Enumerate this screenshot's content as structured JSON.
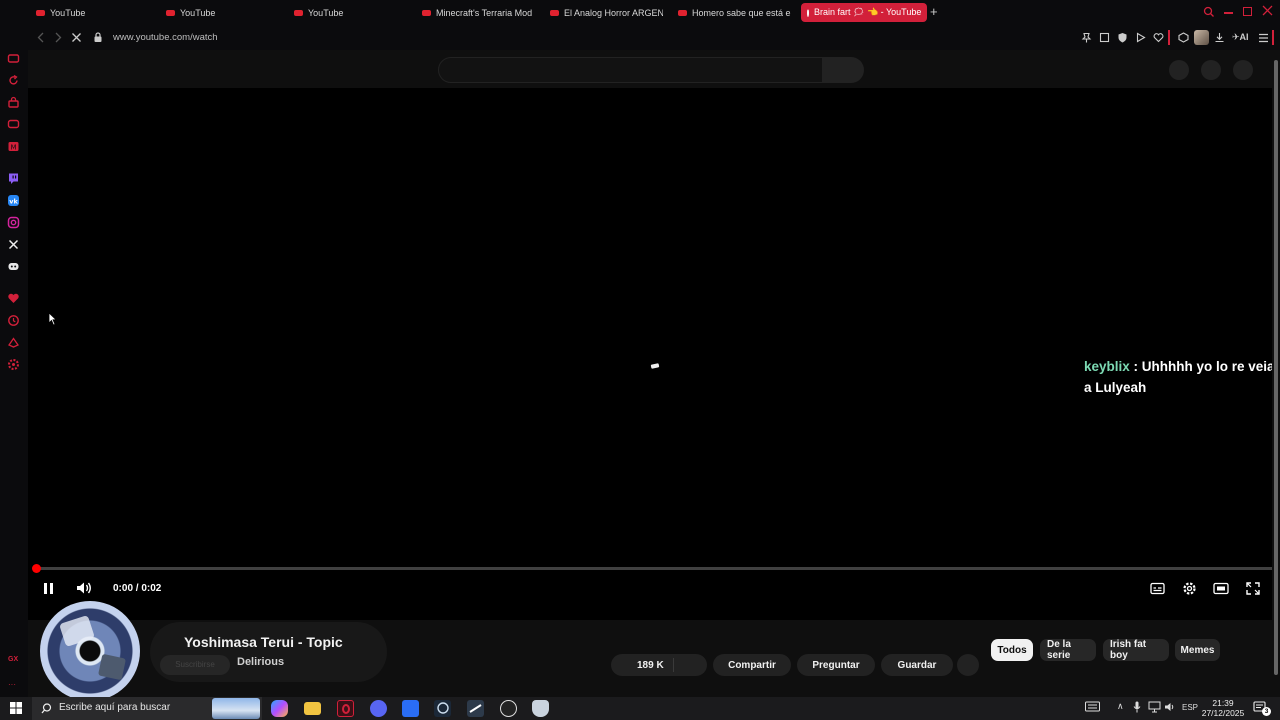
{
  "browser": {
    "tabs": [
      {
        "label": "YouTube",
        "active": false
      },
      {
        "label": "YouTube",
        "active": false
      },
      {
        "label": "YouTube",
        "active": false
      },
      {
        "label": "Minecraft's Terraria Mod o",
        "active": false
      },
      {
        "label": "El Analog Horror ARGENTI",
        "active": false
      },
      {
        "label": "Homero sabe que está en",
        "active": false
      },
      {
        "label": "Brain fart 🗯 👈 - YouTube",
        "active": true
      }
    ],
    "url": "www.youtube.com/watch",
    "ai_label": "AI",
    "accent": "#d2203a"
  },
  "sidebar": {
    "icons": [
      "wallet-icon",
      "reload-icon",
      "bag-icon",
      "chat-icon",
      "mail-icon",
      "twitch-icon",
      "vk-icon",
      "instagram-icon",
      "x-icon",
      "discord-icon",
      "heart-icon",
      "history-icon",
      "extensions-icon",
      "settings-icon"
    ],
    "gx_label": "GX"
  },
  "player": {
    "time": "0:00 / 0:02",
    "progress": 0.0,
    "chat": {
      "user": "keyblix",
      "separator": " : ",
      "message": "Uhhhhh yo lo re veia a Lulyeah"
    }
  },
  "video_info": {
    "channel": "Yoshimasa Terui - Topic",
    "song": "Delirious",
    "subscribe_ghost": "Suscribirse",
    "likes": "189 K",
    "share": "Compartir",
    "ask": "Preguntar",
    "save": "Guardar"
  },
  "chips": [
    {
      "label": "Todos",
      "selected": true
    },
    {
      "label": "De la serie",
      "selected": false
    },
    {
      "label": "Irish fat boy",
      "selected": false
    },
    {
      "label": "Memes",
      "selected": false
    }
  ],
  "taskbar": {
    "search_placeholder": "Escribe aquí para buscar",
    "language": "ESP",
    "time": "21:39",
    "date": "27/12/2025",
    "notification_count": "3"
  }
}
